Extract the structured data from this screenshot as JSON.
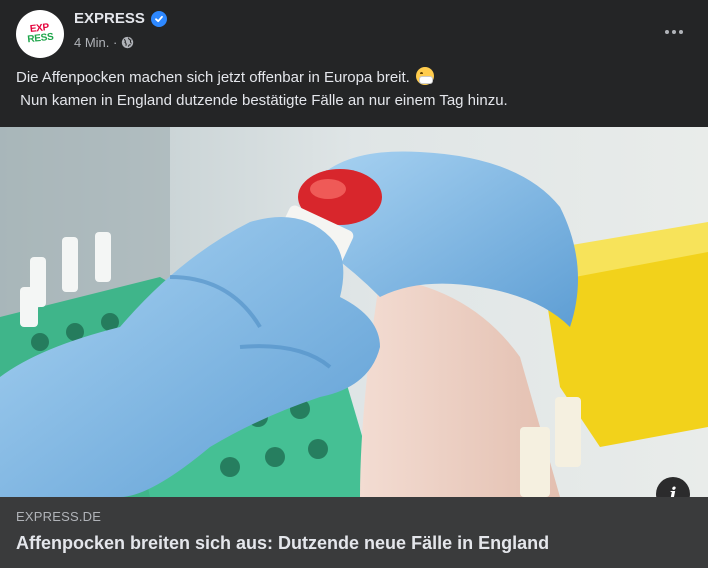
{
  "post": {
    "page_name": "EXPRESS",
    "verified": true,
    "timestamp": "4 Min. ·",
    "avatar_logo": "EXPRESS",
    "text_lines": [
      "Die Affenpocken machen sich jetzt offenbar in Europa breit.",
      " Nun kamen in England dutzende bestätigte Fälle an nur einem Tag hinzu."
    ],
    "emoji": "face-with-medical-mask"
  },
  "link": {
    "domain": "EXPRESS.DE",
    "title": "Affenpocken breiten sich aus: Dutzende neue Fälle in England",
    "info_glyph": "i"
  },
  "icons": {
    "verified": "verified-check-icon",
    "privacy": "globe-icon",
    "more": "more-options-icon",
    "info": "info-icon"
  },
  "colors": {
    "background": "#242526",
    "link_box": "#3a3b3c",
    "verified_blue": "#2d88ff",
    "glove_blue": "#7fb8e6"
  }
}
